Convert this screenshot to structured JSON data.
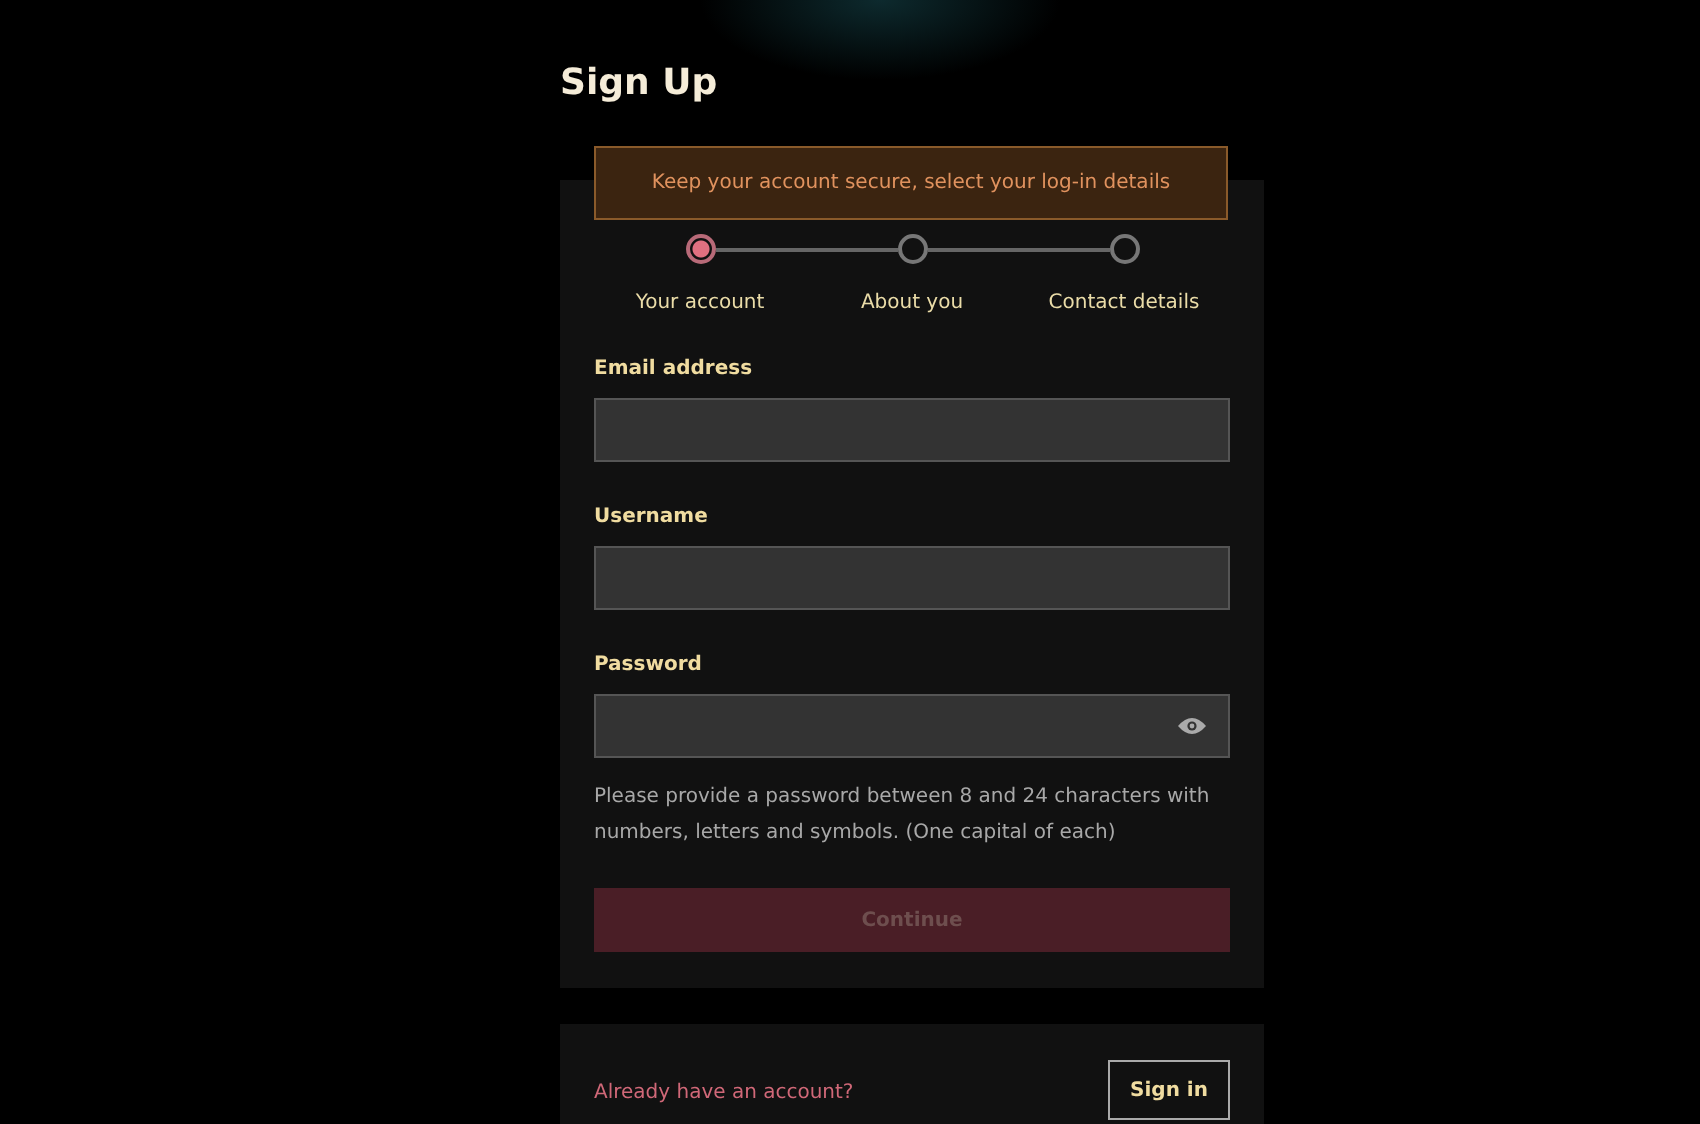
{
  "page_title": "Sign Up",
  "tooltip": "Keep your account secure, select your log-in details",
  "steps": [
    {
      "label": "Your account",
      "selected": true
    },
    {
      "label": "About you",
      "selected": false
    },
    {
      "label": "Contact details",
      "selected": false
    }
  ],
  "fields": [
    {
      "label": "Email address",
      "kind": "text"
    },
    {
      "label": "Username",
      "kind": "text"
    },
    {
      "label": "Password",
      "kind": "password"
    }
  ],
  "password_hint": "Please provide a password between 8 and 24 characters with numbers, letters and symbols. (One capital of each)",
  "continue_button": {
    "label": "Continue",
    "disabled": true
  },
  "footer": {
    "prompt": "Already have an account?",
    "sign_in_button": "Sign in"
  }
}
